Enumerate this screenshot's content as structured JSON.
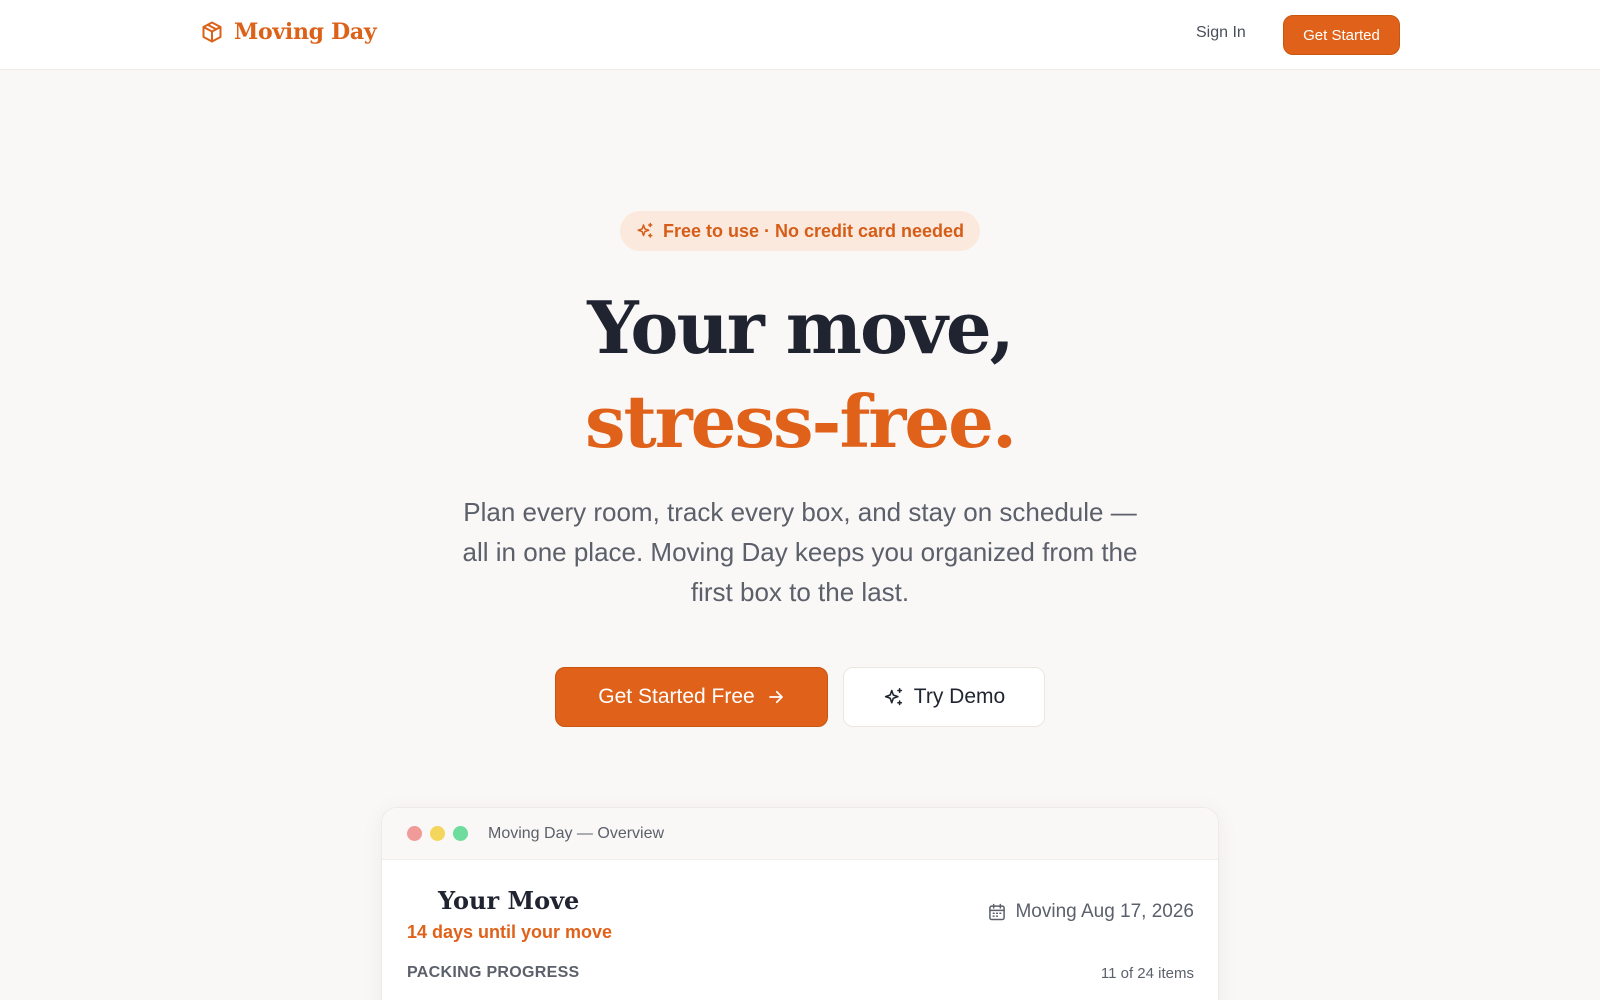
{
  "nav": {
    "brand": "Moving Day",
    "sign_in": "Sign In",
    "get_started": "Get Started"
  },
  "hero": {
    "badge": "Free to use · No credit card needed",
    "headline_line1": "Your move,",
    "headline_line2": "stress-free.",
    "subtitle": "Plan every room, track every box, and stay on schedule — all in one place. Moving Day keeps you organized from the first box to the last.",
    "primary_cta": "Get Started Free",
    "secondary_cta": "Try Demo"
  },
  "preview": {
    "window_title": "Moving Day — Overview",
    "move_title": "Your Move",
    "countdown": "14 days until your move",
    "move_date": "Moving Aug 17, 2026",
    "progress_label": "PACKING PROGRESS",
    "progress_count": "11 of 24 items"
  },
  "colors": {
    "accent": "#e0621a",
    "text": "#1f2430",
    "muted": "#5b606b",
    "background": "#faf8f6",
    "badge_bg": "#fbe9dd"
  },
  "icons": {
    "brand": "box-icon",
    "badge": "sparkles-icon",
    "primary_cta": "arrow-right-icon",
    "secondary_cta": "sparkles-icon",
    "date": "calendar-icon"
  }
}
